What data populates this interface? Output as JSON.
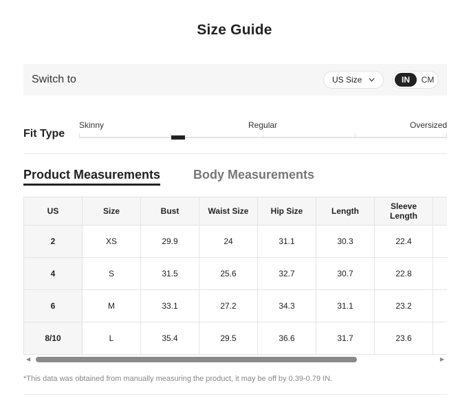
{
  "title": "Size Guide",
  "switch_bar": {
    "label": "Switch to",
    "size_select": {
      "value": "US Size",
      "icon": "chevron-down-icon"
    },
    "units": {
      "active": "IN",
      "inactive": "CM"
    }
  },
  "fit_type": {
    "label": "Fit Type",
    "scale": [
      "Skinny",
      "Regular",
      "Oversized"
    ],
    "selected_position": 0.27
  },
  "tabs": {
    "active": "Product Measurements",
    "inactive": "Body Measurements"
  },
  "table": {
    "headers": [
      "US",
      "Size",
      "Bust",
      "Waist Size",
      "Hip Size",
      "Length",
      "Sleeve\nLength",
      ""
    ],
    "rows": [
      [
        "2",
        "XS",
        "29.9",
        "24",
        "31.1",
        "30.3",
        "22.4",
        ""
      ],
      [
        "4",
        "S",
        "31.5",
        "25.6",
        "32.7",
        "30.7",
        "22.8",
        ""
      ],
      [
        "6",
        "M",
        "33.1",
        "27.2",
        "34.3",
        "31.1",
        "23.2",
        ""
      ],
      [
        "8/10",
        "L",
        "35.4",
        "29.5",
        "36.6",
        "31.7",
        "23.6",
        ""
      ]
    ]
  },
  "scrollbar": {
    "left_icon": "scroll-left-arrow-icon",
    "right_icon": "scroll-right-arrow-icon",
    "scroll_position": 0.0,
    "visible_fraction": 0.77
  },
  "note": "*This data was obtained from manually measuring the product, it may be off by 0.39-0.79 IN."
}
